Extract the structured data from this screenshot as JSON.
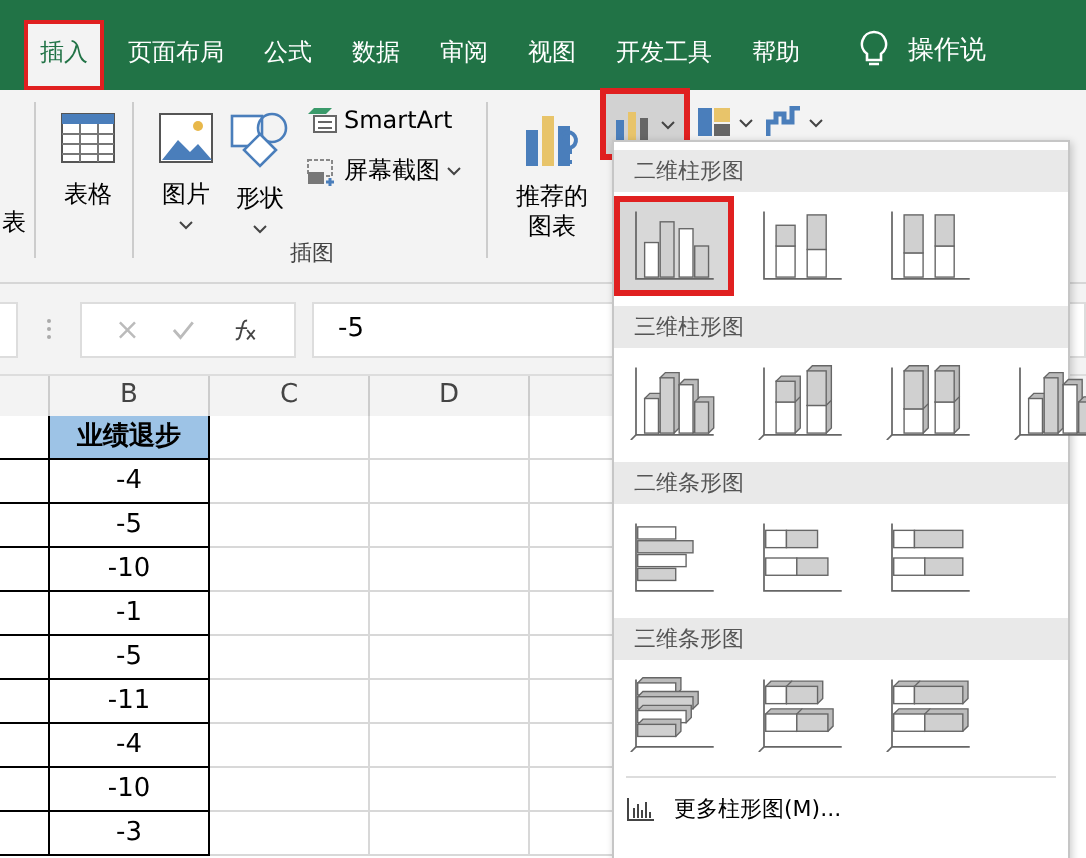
{
  "tabs": [
    {
      "label": "插入",
      "selected": true
    },
    {
      "label": "页面布局",
      "selected": false
    },
    {
      "label": "公式",
      "selected": false
    },
    {
      "label": "数据",
      "selected": false
    },
    {
      "label": "审阅",
      "selected": false
    },
    {
      "label": "视图",
      "selected": false
    },
    {
      "label": "开发工具",
      "selected": false
    },
    {
      "label": "帮助",
      "selected": false
    }
  ],
  "tell_me": {
    "label": "操作说"
  },
  "ribbon": {
    "cut_label": "表",
    "table_label": "表格",
    "picture_label": "图片",
    "shapes_label": "形状",
    "smartart_label": "SmartArt",
    "screenshot_label": "屏幕截图",
    "group_label": "插图",
    "recommended_label": "推荐的图表"
  },
  "formula_bar": {
    "value": "-5"
  },
  "sheet": {
    "columns": [
      "B",
      "C",
      "D"
    ],
    "header": "业绩退步",
    "values": [
      "-4",
      "-5",
      "-10",
      "-1",
      "-5",
      "-11",
      "-4",
      "-10",
      "-3"
    ]
  },
  "dropdown": {
    "sections": [
      {
        "title": "二维柱形图",
        "kind": "col2d",
        "items": [
          {
            "selected": true
          },
          {
            "selected": false
          },
          {
            "selected": false
          }
        ]
      },
      {
        "title": "三维柱形图",
        "kind": "col3d",
        "items": [
          {
            "selected": false
          },
          {
            "selected": false
          },
          {
            "selected": false
          },
          {
            "selected": false
          }
        ]
      },
      {
        "title": "二维条形图",
        "kind": "bar2d",
        "items": [
          {
            "selected": false
          },
          {
            "selected": false
          },
          {
            "selected": false
          }
        ]
      },
      {
        "title": "三维条形图",
        "kind": "bar3d",
        "items": [
          {
            "selected": false
          },
          {
            "selected": false
          },
          {
            "selected": false
          }
        ]
      }
    ],
    "more": "更多柱形图(M)..."
  }
}
